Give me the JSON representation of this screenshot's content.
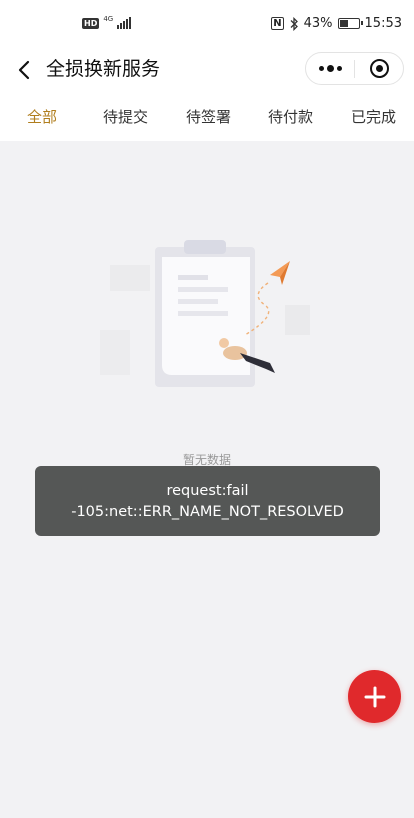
{
  "status_bar": {
    "hd_label": "HD",
    "network_label": "4G",
    "nfc_label": "N",
    "battery_percent": "43%",
    "time": "15:53"
  },
  "navbar": {
    "title": "全损换新服务"
  },
  "tabs": [
    {
      "label": "全部",
      "active": true
    },
    {
      "label": "待提交",
      "active": false
    },
    {
      "label": "待签署",
      "active": false
    },
    {
      "label": "待付款",
      "active": false
    },
    {
      "label": "已完成",
      "active": false
    }
  ],
  "empty_state": {
    "text": "暂无数据"
  },
  "toast": {
    "line1": "request:fail",
    "line2": "-105:net::ERR_NAME_NOT_RESOLVED"
  },
  "colors": {
    "active_tab": "#b07e1e",
    "fab": "#e0292c",
    "toast_bg": "#555756",
    "page_bg": "#f2f2f4"
  },
  "icons": {
    "back": "chevron-left-icon",
    "more": "more-dots-icon",
    "close_target": "target-circle-icon",
    "fab": "plus-icon"
  }
}
